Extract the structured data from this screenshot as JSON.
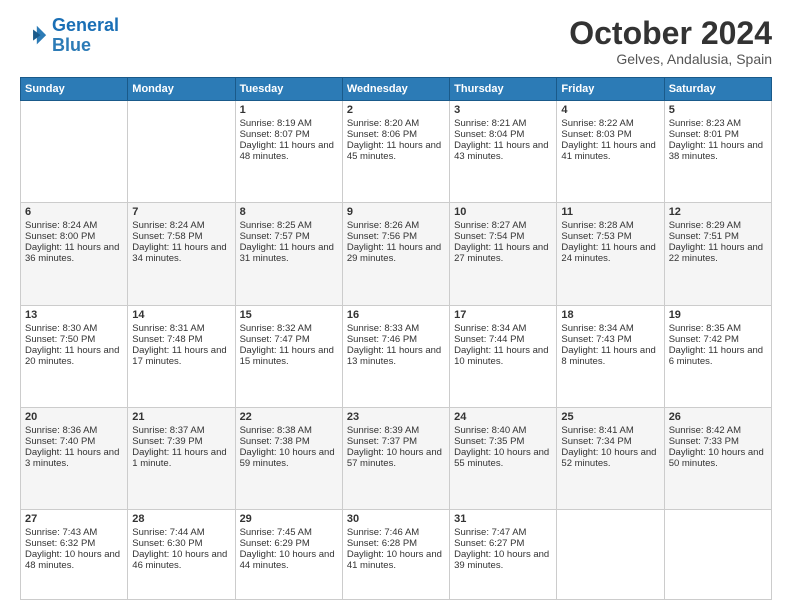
{
  "logo": {
    "text_general": "General",
    "text_blue": "Blue"
  },
  "title": "October 2024",
  "subtitle": "Gelves, Andalusia, Spain",
  "header_days": [
    "Sunday",
    "Monday",
    "Tuesday",
    "Wednesday",
    "Thursday",
    "Friday",
    "Saturday"
  ],
  "weeks": [
    [
      {
        "day": "",
        "content": ""
      },
      {
        "day": "",
        "content": ""
      },
      {
        "day": "1",
        "content": "Sunrise: 8:19 AM\nSunset: 8:07 PM\nDaylight: 11 hours and 48 minutes."
      },
      {
        "day": "2",
        "content": "Sunrise: 8:20 AM\nSunset: 8:06 PM\nDaylight: 11 hours and 45 minutes."
      },
      {
        "day": "3",
        "content": "Sunrise: 8:21 AM\nSunset: 8:04 PM\nDaylight: 11 hours and 43 minutes."
      },
      {
        "day": "4",
        "content": "Sunrise: 8:22 AM\nSunset: 8:03 PM\nDaylight: 11 hours and 41 minutes."
      },
      {
        "day": "5",
        "content": "Sunrise: 8:23 AM\nSunset: 8:01 PM\nDaylight: 11 hours and 38 minutes."
      }
    ],
    [
      {
        "day": "6",
        "content": "Sunrise: 8:24 AM\nSunset: 8:00 PM\nDaylight: 11 hours and 36 minutes."
      },
      {
        "day": "7",
        "content": "Sunrise: 8:24 AM\nSunset: 7:58 PM\nDaylight: 11 hours and 34 minutes."
      },
      {
        "day": "8",
        "content": "Sunrise: 8:25 AM\nSunset: 7:57 PM\nDaylight: 11 hours and 31 minutes."
      },
      {
        "day": "9",
        "content": "Sunrise: 8:26 AM\nSunset: 7:56 PM\nDaylight: 11 hours and 29 minutes."
      },
      {
        "day": "10",
        "content": "Sunrise: 8:27 AM\nSunset: 7:54 PM\nDaylight: 11 hours and 27 minutes."
      },
      {
        "day": "11",
        "content": "Sunrise: 8:28 AM\nSunset: 7:53 PM\nDaylight: 11 hours and 24 minutes."
      },
      {
        "day": "12",
        "content": "Sunrise: 8:29 AM\nSunset: 7:51 PM\nDaylight: 11 hours and 22 minutes."
      }
    ],
    [
      {
        "day": "13",
        "content": "Sunrise: 8:30 AM\nSunset: 7:50 PM\nDaylight: 11 hours and 20 minutes."
      },
      {
        "day": "14",
        "content": "Sunrise: 8:31 AM\nSunset: 7:48 PM\nDaylight: 11 hours and 17 minutes."
      },
      {
        "day": "15",
        "content": "Sunrise: 8:32 AM\nSunset: 7:47 PM\nDaylight: 11 hours and 15 minutes."
      },
      {
        "day": "16",
        "content": "Sunrise: 8:33 AM\nSunset: 7:46 PM\nDaylight: 11 hours and 13 minutes."
      },
      {
        "day": "17",
        "content": "Sunrise: 8:34 AM\nSunset: 7:44 PM\nDaylight: 11 hours and 10 minutes."
      },
      {
        "day": "18",
        "content": "Sunrise: 8:34 AM\nSunset: 7:43 PM\nDaylight: 11 hours and 8 minutes."
      },
      {
        "day": "19",
        "content": "Sunrise: 8:35 AM\nSunset: 7:42 PM\nDaylight: 11 hours and 6 minutes."
      }
    ],
    [
      {
        "day": "20",
        "content": "Sunrise: 8:36 AM\nSunset: 7:40 PM\nDaylight: 11 hours and 3 minutes."
      },
      {
        "day": "21",
        "content": "Sunrise: 8:37 AM\nSunset: 7:39 PM\nDaylight: 11 hours and 1 minute."
      },
      {
        "day": "22",
        "content": "Sunrise: 8:38 AM\nSunset: 7:38 PM\nDaylight: 10 hours and 59 minutes."
      },
      {
        "day": "23",
        "content": "Sunrise: 8:39 AM\nSunset: 7:37 PM\nDaylight: 10 hours and 57 minutes."
      },
      {
        "day": "24",
        "content": "Sunrise: 8:40 AM\nSunset: 7:35 PM\nDaylight: 10 hours and 55 minutes."
      },
      {
        "day": "25",
        "content": "Sunrise: 8:41 AM\nSunset: 7:34 PM\nDaylight: 10 hours and 52 minutes."
      },
      {
        "day": "26",
        "content": "Sunrise: 8:42 AM\nSunset: 7:33 PM\nDaylight: 10 hours and 50 minutes."
      }
    ],
    [
      {
        "day": "27",
        "content": "Sunrise: 7:43 AM\nSunset: 6:32 PM\nDaylight: 10 hours and 48 minutes."
      },
      {
        "day": "28",
        "content": "Sunrise: 7:44 AM\nSunset: 6:30 PM\nDaylight: 10 hours and 46 minutes."
      },
      {
        "day": "29",
        "content": "Sunrise: 7:45 AM\nSunset: 6:29 PM\nDaylight: 10 hours and 44 minutes."
      },
      {
        "day": "30",
        "content": "Sunrise: 7:46 AM\nSunset: 6:28 PM\nDaylight: 10 hours and 41 minutes."
      },
      {
        "day": "31",
        "content": "Sunrise: 7:47 AM\nSunset: 6:27 PM\nDaylight: 10 hours and 39 minutes."
      },
      {
        "day": "",
        "content": ""
      },
      {
        "day": "",
        "content": ""
      }
    ]
  ]
}
